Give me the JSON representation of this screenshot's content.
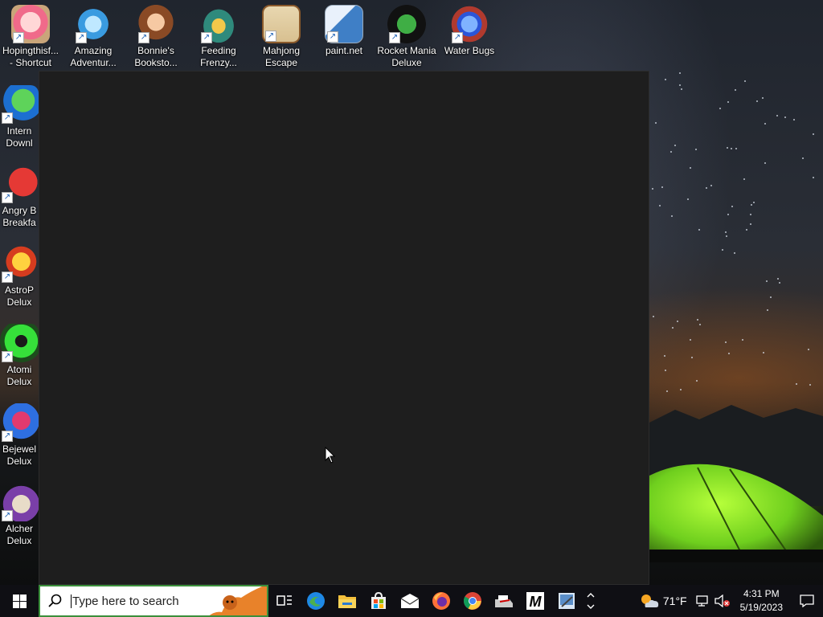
{
  "desktop": {
    "icons_top": [
      {
        "label": "Hopingthisf... - Shortcut",
        "icon": "anime-girl-icon"
      },
      {
        "label": "Amazing Adventur...",
        "icon": "diamond-icon"
      },
      {
        "label": "Bonnie's Booksto...",
        "icon": "bonnie-face-icon"
      },
      {
        "label": "Feeding Frenzy...",
        "icon": "fish-icon"
      },
      {
        "label": "Mahjong Escape Anci...",
        "icon": "torii-gate-icon"
      },
      {
        "label": "paint.net",
        "icon": "paint-icon"
      },
      {
        "label": "Rocket Mania Deluxe",
        "icon": "rocket-icon"
      },
      {
        "label": "Water Bugs",
        "icon": "porthole-icon"
      }
    ],
    "icons_left": [
      {
        "label": "Intern Downl",
        "icon": "globe-download-icon"
      },
      {
        "label": "Angry B Breakfa",
        "icon": "angry-bird-icon"
      },
      {
        "label": "AstroP Delux",
        "icon": "astro-star-icon"
      },
      {
        "label": "Atomi Delux",
        "icon": "radiation-icon"
      },
      {
        "label": "Bejewel Delux",
        "icon": "gem-2-icon"
      },
      {
        "label": "Alcher Delux",
        "icon": "wizard-icon"
      }
    ]
  },
  "taskbar": {
    "search_placeholder": "Type here to search",
    "pinned": [
      "task-view-icon",
      "edge-icon",
      "file-explorer-icon",
      "store-icon",
      "mail-icon",
      "firefox-icon",
      "chrome-icon",
      "printer-app-icon",
      "m-app-icon",
      "paint-net-icon"
    ],
    "weather_temp": "71°F",
    "clock_time": "4:31 PM",
    "clock_date": "5/19/2023"
  },
  "colors": {
    "window_bg": "#1e1e1e",
    "taskbar_bg": "#0f0f14",
    "search_border": "#3b8f3b"
  }
}
